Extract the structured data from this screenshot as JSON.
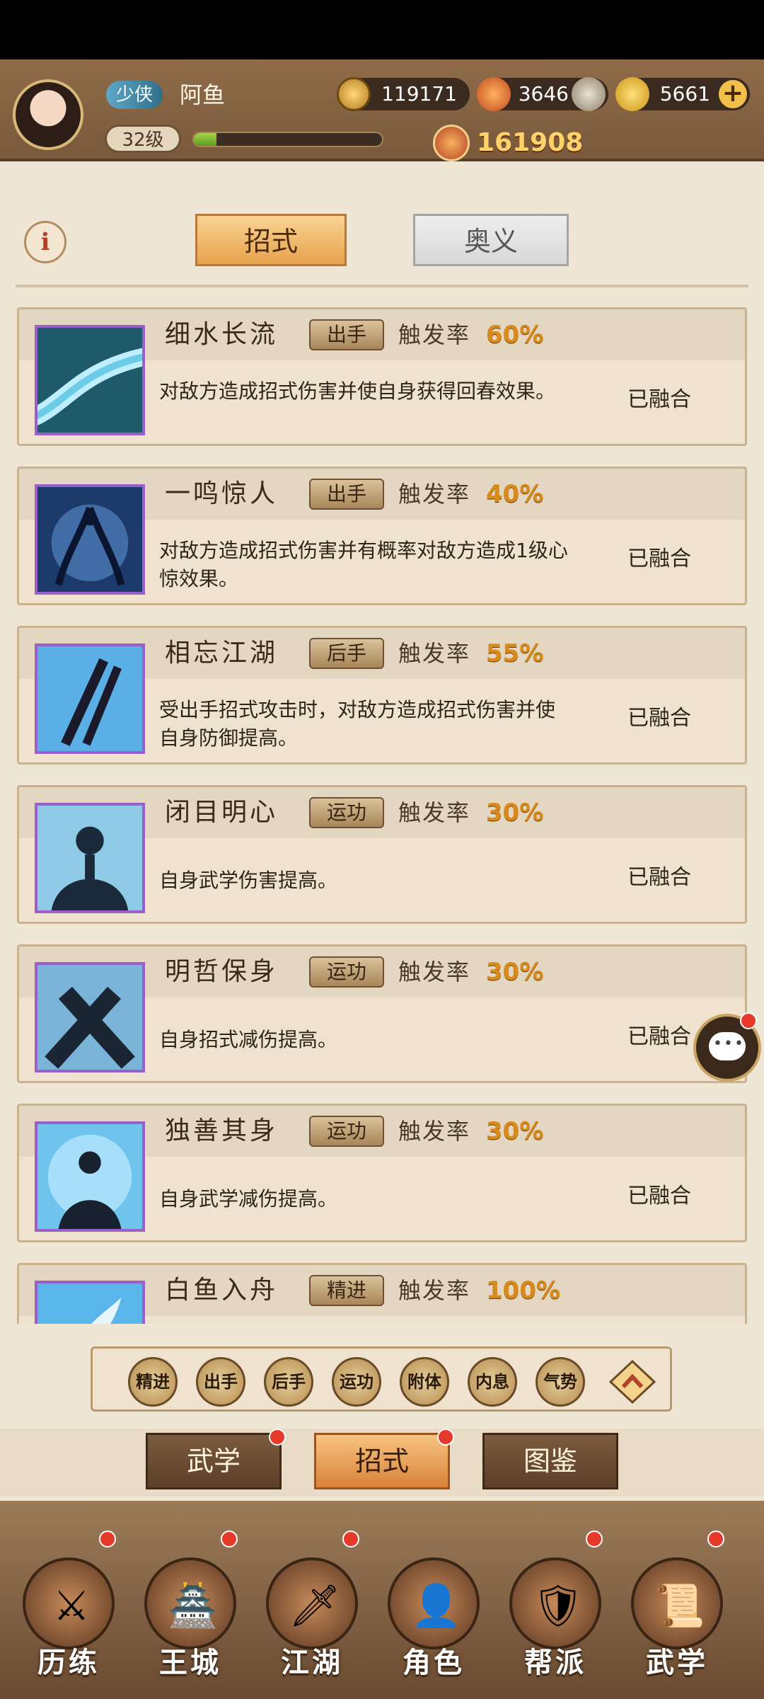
{
  "player": {
    "title": "少侠",
    "name": "阿鱼",
    "level": "32级",
    "exp_fraction": 0.12,
    "power": "161908"
  },
  "resources": {
    "coins": "119171",
    "tokens": "3646",
    "gold": "5661"
  },
  "segment": {
    "info": "i",
    "active": "招式",
    "inactive": "奥义"
  },
  "skills": [
    {
      "name": "细水长流",
      "tag": "出手",
      "rate_label": "触发率",
      "rate": "60%",
      "desc": "对敌方造成招式伤害并使自身获得回春效果。",
      "status": "已融合",
      "thumb": "river"
    },
    {
      "name": "一鸣惊人",
      "tag": "出手",
      "rate_label": "触发率",
      "rate": "40%",
      "desc": "对敌方造成招式伤害并有概率对敌方造成1级心惊效果。",
      "status": "已融合",
      "thumb": "phoenix"
    },
    {
      "name": "相忘江湖",
      "tag": "后手",
      "rate_label": "触发率",
      "rate": "55%",
      "desc": "受出手招式攻击时，对敌方造成招式伤害并使自身防御提高。",
      "status": "已融合",
      "thumb": "swords"
    },
    {
      "name": "闭目明心",
      "tag": "运功",
      "rate_label": "触发率",
      "rate": "30%",
      "desc": "自身武学伤害提高。",
      "status": "已融合",
      "thumb": "meditate"
    },
    {
      "name": "明哲保身",
      "tag": "运功",
      "rate_label": "触发率",
      "rate": "30%",
      "desc": "自身招式减伤提高。",
      "status": "已融合",
      "thumb": "guard"
    },
    {
      "name": "独善其身",
      "tag": "运功",
      "rate_label": "触发率",
      "rate": "30%",
      "desc": "自身武学减伤提高。",
      "status": "已融合",
      "thumb": "monk"
    },
    {
      "name": "白鱼入舟",
      "tag": "精进",
      "rate_label": "触发率",
      "rate": "100%",
      "desc": "",
      "status": "",
      "thumb": "feather"
    }
  ],
  "filters": [
    "精进",
    "出手",
    "后手",
    "运功",
    "附体",
    "内息",
    "气势"
  ],
  "subtabs": [
    "武学",
    "招式",
    "图鉴"
  ],
  "nav": [
    "历练",
    "王城",
    "江湖",
    "角色",
    "帮派",
    "武学"
  ],
  "colors": {
    "accent": "#e7a24c",
    "rate": "#d88a1c",
    "thumb_border": "#9a5fc9",
    "badge": "#e53a2a"
  }
}
